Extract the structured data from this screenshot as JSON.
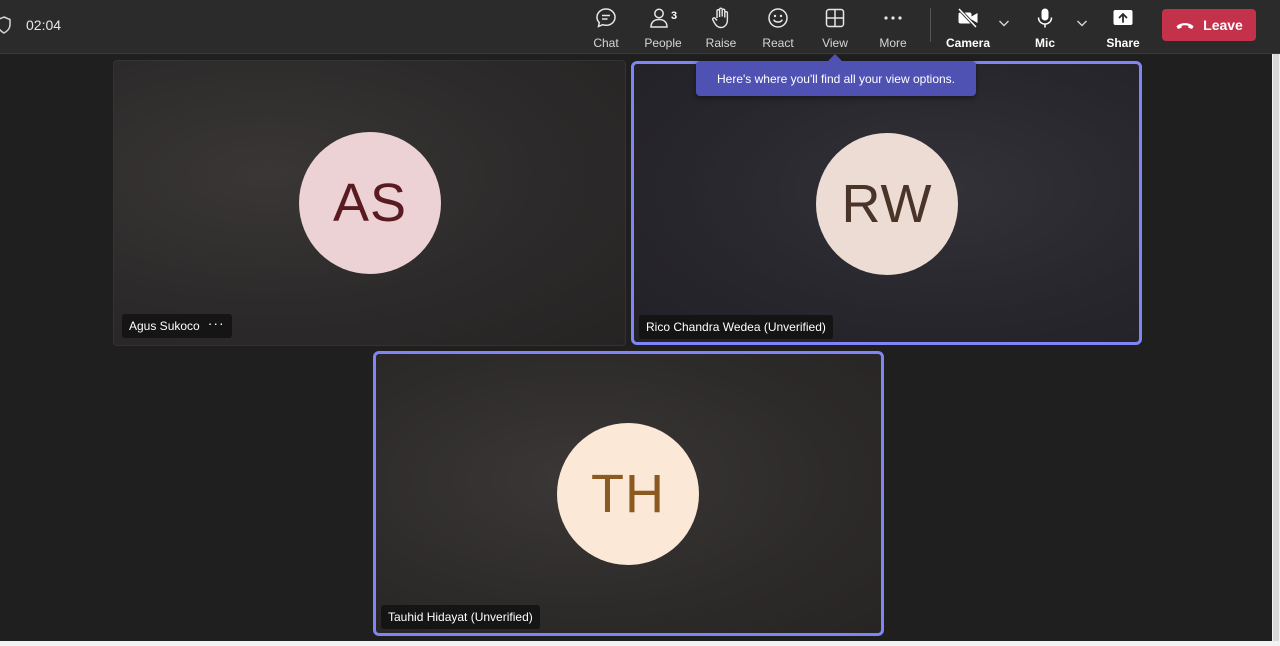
{
  "meeting": {
    "timer": "02:04"
  },
  "toolbar": {
    "chat_label": "Chat",
    "people_label": "People",
    "people_count": "3",
    "raise_label": "Raise",
    "react_label": "React",
    "view_label": "View",
    "more_label": "More",
    "camera_label": "Camera",
    "mic_label": "Mic",
    "share_label": "Share",
    "leave_label": "Leave"
  },
  "tooltip": {
    "text": "Here's where you'll find all your view options."
  },
  "participants": [
    {
      "initials": "AS",
      "name": "Agus Sukoco",
      "more": "···"
    },
    {
      "initials": "RW",
      "name": "Rico Chandra Wedea (Unverified)"
    },
    {
      "initials": "TH",
      "name": "Tauhid Hidayat (Unverified)"
    }
  ],
  "colors": {
    "leave": "#c4314b",
    "highlight_border": "#7f85f5",
    "tooltip": "#4f52b2"
  }
}
